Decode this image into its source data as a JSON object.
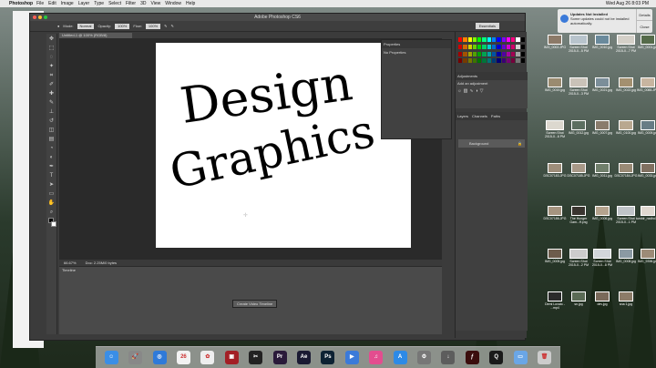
{
  "menubar": {
    "app_name": "Photoshop",
    "items": [
      "File",
      "Edit",
      "Image",
      "Layer",
      "Type",
      "Select",
      "Filter",
      "3D",
      "View",
      "Window",
      "Help"
    ],
    "clock": "Wed Aug 26 8:03 PM"
  },
  "photoshop": {
    "window_title": "Adobe Photoshop CS6",
    "options": {
      "mode_label": "Mode:",
      "mode_value": "Normal",
      "opacity_label": "Opacity:",
      "opacity_value": "100%",
      "flow_label": "Flow:",
      "flow_value": "100%"
    },
    "workspace": "Essentials",
    "doc_tab": "Untitled-1 @ 100% (RGB/8)",
    "status_zoom": "66.67%",
    "status_doc": "Doc: 2.25M/0 bytes",
    "timeline_label": "Timeline",
    "create_video_button": "Create Video Timeline",
    "properties_title": "Properties",
    "properties_empty": "No Properties",
    "adjustments_title": "Adjustments",
    "adjustments_hint": "Add an adjustment",
    "layers_tabs": [
      "Layers",
      "Channels",
      "Paths"
    ],
    "layer_name": "Background"
  },
  "canvas_text": [
    "Design",
    "Graphics"
  ],
  "notification": {
    "title": "Updates Not Installed",
    "body": "Some updates could not be installed automatically.",
    "button_top": "Details",
    "button_bottom": "Close"
  },
  "desktop_icons": [
    {
      "label": "IMG_0002.JPG",
      "color": "#8c7a68"
    },
    {
      "label": "Screen Shot 2015-0...5 PM",
      "color": "#b8c4cc"
    },
    {
      "label": "IMG_0010.jpg",
      "color": "#6a8a9c"
    },
    {
      "label": "Screen Shot 2015-0...7 PM",
      "color": "#d4d0c8"
    },
    {
      "label": "IMG_0001.jpg",
      "color": "#556b4a"
    },
    {
      "label": "IMG_0019.jpg",
      "color": "#9a8b70"
    },
    {
      "label": "Screen Shot 2015-0...3 PM",
      "color": "#c9c2b8"
    },
    {
      "label": "IMG_0021.jpg",
      "color": "#7b8e99"
    },
    {
      "label": "IMG_0022.jpg",
      "color": "#a39070"
    },
    {
      "label": "IMG_0088.JPG",
      "color": "#c8b5a0"
    },
    {
      "label": "Screen Shot 2015-0...6 PM",
      "color": "#dcd8cf"
    },
    {
      "label": "IMG_0012.jpg",
      "color": "#5b6e60"
    },
    {
      "label": "IMG_0007.jpg",
      "color": "#8a7c6c"
    },
    {
      "label": "IMG_0100.jpg",
      "color": "#b9a890"
    },
    {
      "label": "IMG_0009.jpg",
      "color": "#677c85"
    },
    {
      "label": "DSC07183.JPG",
      "color": "#9e8e7a"
    },
    {
      "label": "DSC07185.JPG",
      "color": "#a89988"
    },
    {
      "label": "IMG_0011.jpg",
      "color": "#707f6b"
    },
    {
      "label": "DSC07184.JPG",
      "color": "#998a75"
    },
    {
      "label": "IMG_0033.jpg",
      "color": "#807060"
    },
    {
      "label": "DSC07186.JPG",
      "color": "#a59480"
    },
    {
      "label": "The Hunger Gam...ff.png",
      "color": "#3a3530"
    },
    {
      "label": "IMG_0006.jpg",
      "color": "#b4a38e"
    },
    {
      "label": "Screen Shot 2015-0...1 PM",
      "color": "#c0c4c8"
    },
    {
      "label": "tumblr_nxdhx1jdHVxe1...60.png",
      "color": "#e0d8d0"
    },
    {
      "label": "IMG_0005.jpg",
      "color": "#6d5c4c"
    },
    {
      "label": "Screen Shot 2015-0...2 PM",
      "color": "#cccccc"
    },
    {
      "label": "Screen Shot 2015-0...8 PM",
      "color": "#d2d6da"
    },
    {
      "label": "IMG_0008.jpg",
      "color": "#8b9aa3"
    },
    {
      "label": "IMG_9396.jpg",
      "color": "#9c8b77"
    },
    {
      "label": "Demi Lovato - ...mp4",
      "color": "#2b2b2b"
    },
    {
      "label": "sn.jpg",
      "color": "#5a6b55"
    },
    {
      "label": "dev.jpg",
      "color": "#7a6a5a"
    },
    {
      "label": "sna 1.jpg",
      "color": "#8c7c68"
    }
  ],
  "dock": {
    "apps": [
      {
        "name": "finder-icon",
        "glyph": "☺",
        "color": "#3a8ee6"
      },
      {
        "name": "launchpad-icon",
        "glyph": "🚀",
        "color": "#888888"
      },
      {
        "name": "safari-icon",
        "glyph": "◎",
        "color": "#2f7ad9"
      },
      {
        "name": "calendar-icon",
        "glyph": "26",
        "color": "#f2f2f2"
      },
      {
        "name": "photos-icon",
        "glyph": "✿",
        "color": "#eeeeee"
      },
      {
        "name": "photo-booth-icon",
        "glyph": "▣",
        "color": "#a31f25"
      },
      {
        "name": "final-cut-icon",
        "glyph": "✂",
        "color": "#222222"
      },
      {
        "name": "premiere-icon",
        "glyph": "Pr",
        "color": "#2a1a3a"
      },
      {
        "name": "after-effects-icon",
        "glyph": "Ae",
        "color": "#1a1a33"
      },
      {
        "name": "photoshop-icon",
        "glyph": "Ps",
        "color": "#0d2233"
      },
      {
        "name": "keynote-icon",
        "glyph": "▶",
        "color": "#3b7ad9"
      },
      {
        "name": "itunes-icon",
        "glyph": "♫",
        "color": "#e34d8f"
      },
      {
        "name": "app-store-icon",
        "glyph": "A",
        "color": "#2d8ae6"
      },
      {
        "name": "system-preferences-icon",
        "glyph": "⚙",
        "color": "#777777"
      },
      {
        "name": "downloads-icon",
        "glyph": "↓",
        "color": "#5d5d5d"
      },
      {
        "name": "flash-icon",
        "glyph": "ƒ",
        "color": "#3b0d0d"
      },
      {
        "name": "quicktime-icon",
        "glyph": "Q",
        "color": "#1a1a1a"
      },
      {
        "name": "folder-icon",
        "glyph": "▭",
        "color": "#6aa6e6"
      },
      {
        "name": "trash-icon",
        "glyph": "🗑",
        "color": "#cccccc"
      }
    ]
  },
  "colors": {
    "ps_dark": "#3b3b3b",
    "ps_canvas_bg": "#2a2a2a",
    "accent": "#3b7ad9"
  }
}
